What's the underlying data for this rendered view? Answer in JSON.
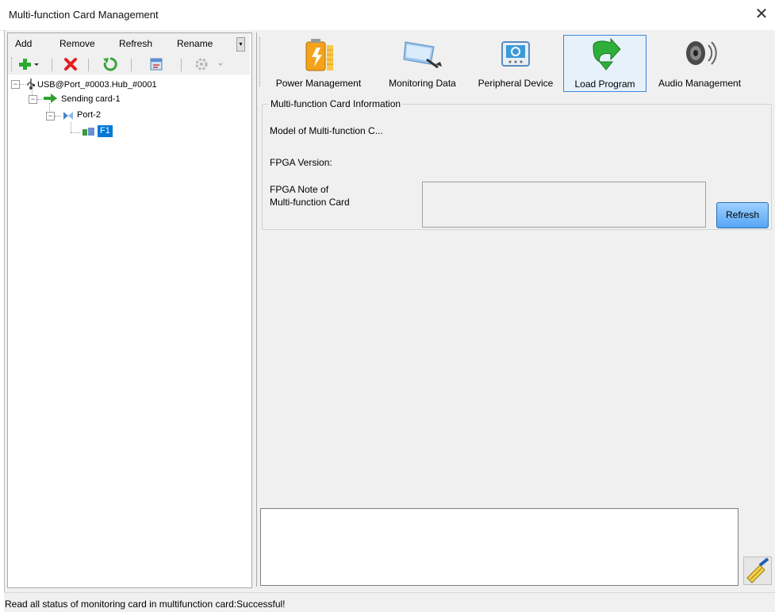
{
  "window": {
    "title": "Multi-function Card Management",
    "close_glyph": "✕"
  },
  "left_menu": {
    "items": [
      "Add",
      "Remove",
      "Refresh",
      "Rename"
    ]
  },
  "left_toolbar": {
    "icons": [
      "add-icon",
      "delete-icon",
      "refresh-icon",
      "properties-icon",
      "settings-icon"
    ]
  },
  "tree": {
    "root": "USB@Port_#0003.Hub_#0001",
    "sending_card": "Sending card-1",
    "port": "Port-2",
    "leaf": "F1"
  },
  "modules": [
    {
      "label": "Power Management",
      "icon": "battery-icon"
    },
    {
      "label": "Monitoring Data",
      "icon": "monitor-icon"
    },
    {
      "label": "Peripheral Device",
      "icon": "device-icon"
    },
    {
      "label": "Load Program",
      "icon": "download-arrow-icon",
      "active": true
    },
    {
      "label": "Audio Management",
      "icon": "speaker-icon"
    }
  ],
  "info": {
    "group_title": "Multi-function Card Information",
    "model_label": "Model of Multi-function C...",
    "fpga_version_label": "FPGA Version:",
    "fpga_note_label_1": "FPGA Note of",
    "fpga_note_label_2": "Multi-function Card",
    "fpga_note_value": "",
    "refresh_label": "Refresh"
  },
  "log": {
    "text": ""
  },
  "status": {
    "text": "Read all status of monitoring card in multifunction card:Successful!"
  },
  "colors": {
    "accent": "#3c86d8",
    "selection": "#0078d7",
    "button_top": "#9fd0ff",
    "button_bottom": "#55a6f5"
  }
}
